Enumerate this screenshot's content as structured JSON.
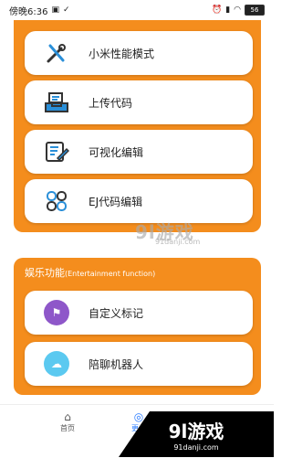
{
  "status_bar": {
    "time": "傍晚6:36",
    "left_icons": [
      "image-icon",
      "check-icon"
    ],
    "right_icons": [
      "alarm-icon",
      "signal-icon",
      "wifi-icon"
    ],
    "battery": "56"
  },
  "top_cards": [
    {
      "label": "小米性能模式",
      "icon": "tools-icon"
    },
    {
      "label": "上传代码",
      "icon": "upload-tray-icon"
    },
    {
      "label": "可视化编辑",
      "icon": "edit-document-icon"
    },
    {
      "label": "EJ代码编辑",
      "icon": "clover-icon"
    }
  ],
  "entertainment": {
    "title": "娱乐功能",
    "subtitle": "(Entertainment function)",
    "items": [
      {
        "label": "自定义标记",
        "icon": "flag-icon"
      },
      {
        "label": "陪聊机器人",
        "icon": "robot-icon"
      }
    ]
  },
  "watermark": {
    "brand": "9l游戏",
    "url": "91danji.com"
  },
  "bottom_nav": {
    "items": [
      {
        "label": "首页",
        "icon": "home-icon"
      },
      {
        "label": "更多",
        "icon": "compass-icon"
      }
    ]
  },
  "corner_badge": {
    "brand": "9l游戏",
    "url": "91danji.com"
  },
  "colors": {
    "panel": "#f48d1d",
    "nav_active": "#2b7cff"
  }
}
